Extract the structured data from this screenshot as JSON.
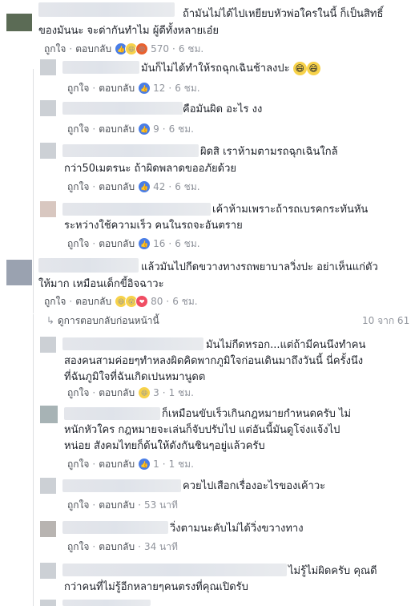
{
  "labels": {
    "like": "ถูกใจ",
    "reply": "ตอบกลับ",
    "dot": "·",
    "prev_replies": "ดูการตอบกลับก่อนหน้านี้",
    "pager": "10 จาก 61"
  },
  "comments": [
    {
      "lines": [
        "ถ้ามันไม่ได้ไปเหยียบหัวพ่อใครในนี้ ก็เป็นสิทธิ์",
        "ของมันนะ จะด่ากันทำไม ผู้ดีทั้งหลายเอ๋ย"
      ],
      "count": "570",
      "time": "6 ชม."
    },
    {
      "lines": [
        "มันก็ไม่ได้ทำให้รถฉุกเฉินช้าลงปะ"
      ],
      "count": "12",
      "time": "6 ชม."
    },
    {
      "lines": [
        "คือมันผิด อะไร งง"
      ],
      "count": "9",
      "time": "6 ชม."
    },
    {
      "lines": [
        "ผิดสิ เราห้ามตามรถฉุกเฉินใกล้",
        "กว่า50เมตรนะ ถ้าผิดพลาดขออภัยด้วย"
      ],
      "count": "42",
      "time": "6 ชม."
    },
    {
      "lines": [
        "เค้าห้ามเพราะถ้ารถเบรคกระทันหัน",
        "ระหว่างใช้ความเร็ว คนในรถจะอันตราย"
      ],
      "count": "16",
      "time": "6 ชม."
    },
    {
      "lines": [
        "แล้วมันไปกีดขวางทางรถพยาบาลวิ่งปะ อย่าเห็นแก่ตัว",
        "ให้มาก เหมือนเด็กขี้อิจฉาวะ"
      ],
      "count": "80",
      "time": "6 ชม."
    },
    {
      "lines": [
        "มันไม่กีดหรอก...แต่ถ้ามีคนนึงทำคน",
        "สองคนสามค่อยๆทำหลงผิดคิดพากภูมิใจก่อนเดินมาถึงวันนี้ นี่ครั้งนึง",
        "ที่ฉันภูมิใจที่ฉันเกิดเปนหมานูดต"
      ],
      "count": "3",
      "time": "1 ชม."
    },
    {
      "lines": [
        "ก็เหมือนขับเร็วเกินกฎหมายกำหนดครับ ไม่",
        "หนักหัวใคร กฎหมายจะเล่นก็จับปรับไป แต่อันนี้มันดูโจ่งแจ้งไป",
        "หน่อย สังคมไทยก็ด้นให้ดังกันชินๆอยู่แล้วครับ"
      ],
      "count": "1",
      "time": "1 ชม."
    },
    {
      "lines": [
        "ควยไปเสือกเรื่องอะไรของเค้าวะ"
      ],
      "count": "",
      "time": "53 นาที"
    },
    {
      "lines": [
        "วิ่งตามนะคับไม่ได้วิ่งขวางทาง"
      ],
      "count": "",
      "time": "34 นาที"
    },
    {
      "lines": [
        "ไม่รู้ไม่ผิดครับ คุณดี",
        "กว่าคนที่ไม่รู้อีกหลายๆคนตรงที่คุณเปิดรับ"
      ],
      "count": "",
      "time": ""
    }
  ]
}
